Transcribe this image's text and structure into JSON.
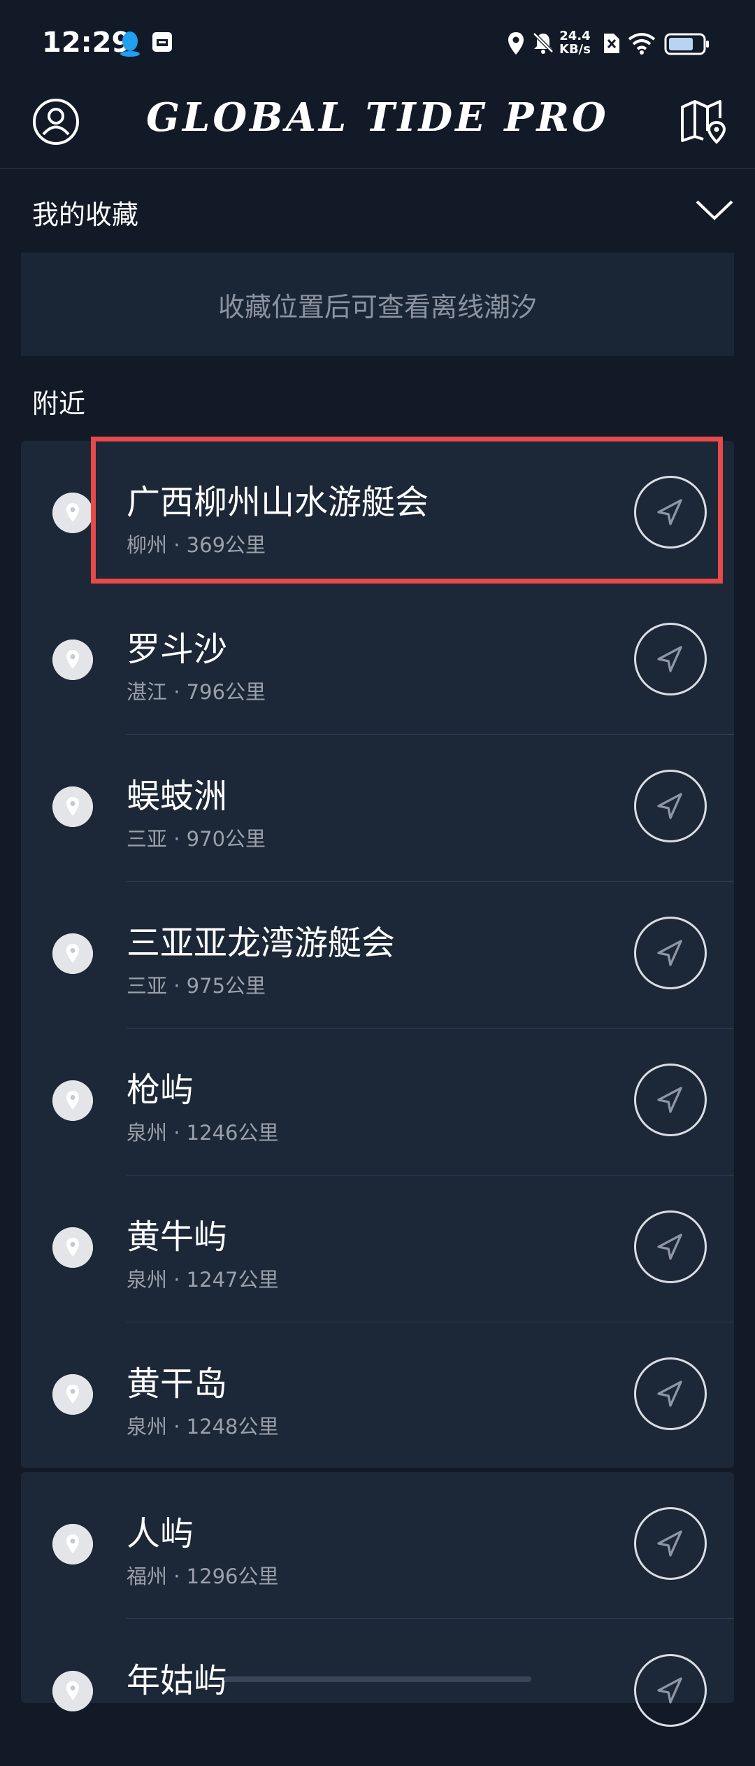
{
  "status_bar": {
    "time": "12:29",
    "net_speed_value": "24.4",
    "net_speed_unit": "KB/s",
    "icons": [
      "qq-icon",
      "inbox-icon",
      "location-icon",
      "mute-icon",
      "no-sim-icon",
      "wifi-icon",
      "battery-icon"
    ]
  },
  "header": {
    "title": "GLOBAL TIDE PRO",
    "left_icon": "profile-icon",
    "right_icon": "map-pin-icon"
  },
  "favorites": {
    "title": "我的收藏",
    "empty_text": "收藏位置后可查看离线潮汐"
  },
  "nearby": {
    "title": "附近",
    "items": [
      {
        "name": "广西柳州山水游艇会",
        "city": "柳州",
        "distance": "369公里"
      },
      {
        "name": "罗斗沙",
        "city": "湛江",
        "distance": "796公里"
      },
      {
        "name": "蜈蚑洲",
        "city": "三亚",
        "distance": "970公里"
      },
      {
        "name": "三亚亚龙湾游艇会",
        "city": "三亚",
        "distance": "975公里"
      },
      {
        "name": "枪屿",
        "city": "泉州",
        "distance": "1246公里"
      },
      {
        "name": "黄牛屿",
        "city": "泉州",
        "distance": "1247公里"
      },
      {
        "name": "黄干岛",
        "city": "泉州",
        "distance": "1248公里"
      },
      {
        "name": "人屿",
        "city": "福州",
        "distance": "1296公里"
      },
      {
        "name": "年姑屿",
        "city": "",
        "distance": ""
      }
    ],
    "separator": " · "
  },
  "colors": {
    "background": "#121a27",
    "panel": "#1c2737",
    "highlight": "#e84949"
  }
}
